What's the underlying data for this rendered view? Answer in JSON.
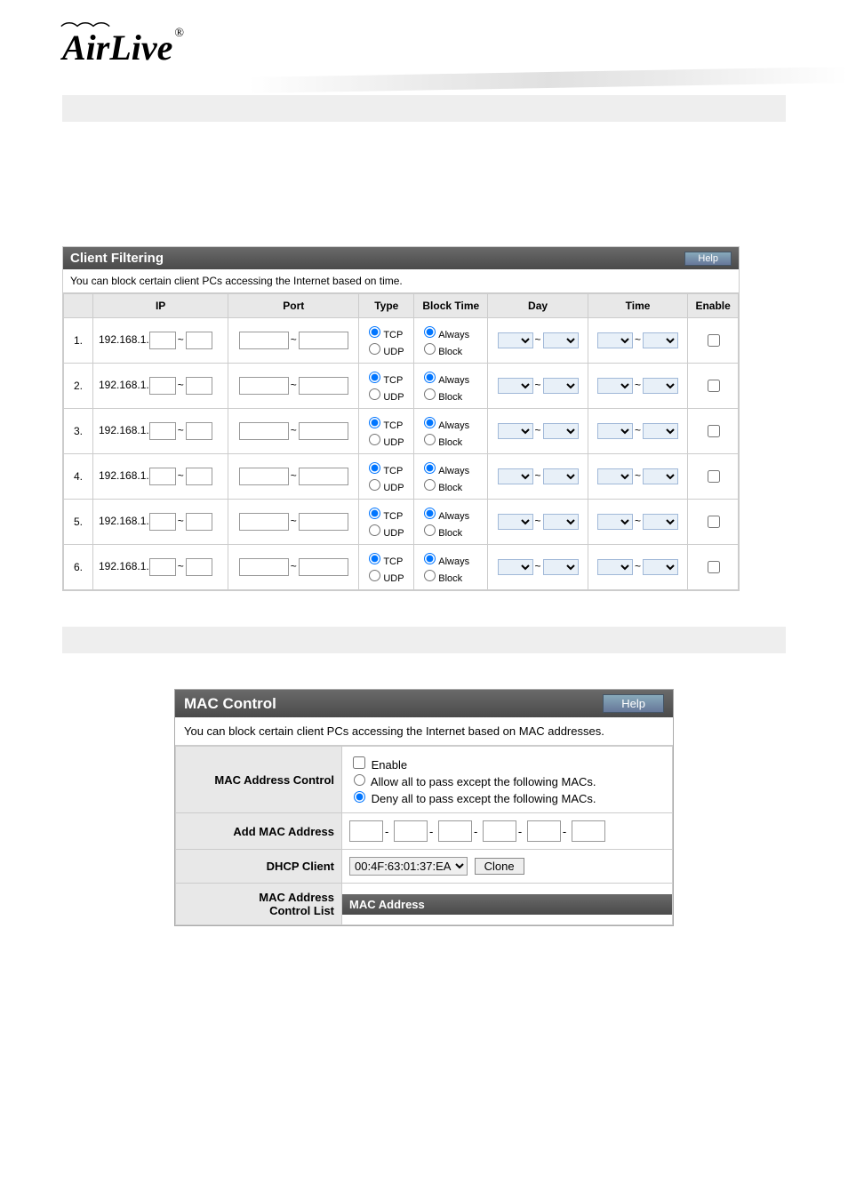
{
  "logo_text": "AirLive",
  "section1": {
    "title": "Client Filtering",
    "help": "Help",
    "subtitle": "You can block certain client PCs accessing the Internet based on time.",
    "headers": {
      "ip": "IP",
      "port": "Port",
      "type": "Type",
      "blocktime": "Block Time",
      "day": "Day",
      "time": "Time",
      "enable": "Enable"
    },
    "type_opts": {
      "tcp": "TCP",
      "udp": "UDP"
    },
    "bt_opts": {
      "always": "Always",
      "block": "Block"
    },
    "ip_prefix": "192.168.1.",
    "rows": [
      1,
      2,
      3,
      4,
      5,
      6
    ]
  },
  "section2": {
    "title": "MAC Control",
    "help": "Help",
    "subtitle": "You can block certain client PCs accessing the Internet based on MAC addresses.",
    "rows": {
      "mac_ctrl_lbl": "MAC Address Control",
      "enable": "Enable",
      "allow": "Allow all to pass except the following MACs.",
      "deny": "Deny all to pass except the following MACs.",
      "add_mac_lbl": "Add MAC Address",
      "dhcp_lbl": "DHCP Client",
      "dhcp_val": "00:4F:63:01:37:EA",
      "clone": "Clone",
      "list_lbl1": "MAC Address",
      "list_lbl2": "Control List",
      "list_hdr": "MAC Address"
    }
  }
}
